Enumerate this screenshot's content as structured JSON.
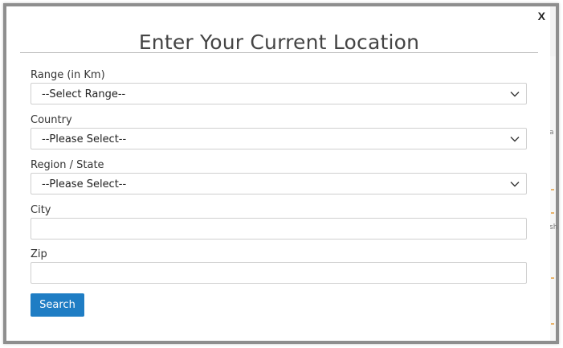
{
  "modal": {
    "close_label": "X",
    "title": "Enter Your Current Location"
  },
  "fields": {
    "range": {
      "label": "Range (in Km)",
      "value": "--Select Range--"
    },
    "country": {
      "label": "Country",
      "value": "--Please Select--"
    },
    "region": {
      "label": "Region / State",
      "value": "--Please Select--"
    },
    "city": {
      "label": "City",
      "value": ""
    },
    "zip": {
      "label": "Zip",
      "value": ""
    }
  },
  "search": {
    "label": "Search"
  },
  "background": {
    "mark_a": "a",
    "mark_b": "sh"
  }
}
